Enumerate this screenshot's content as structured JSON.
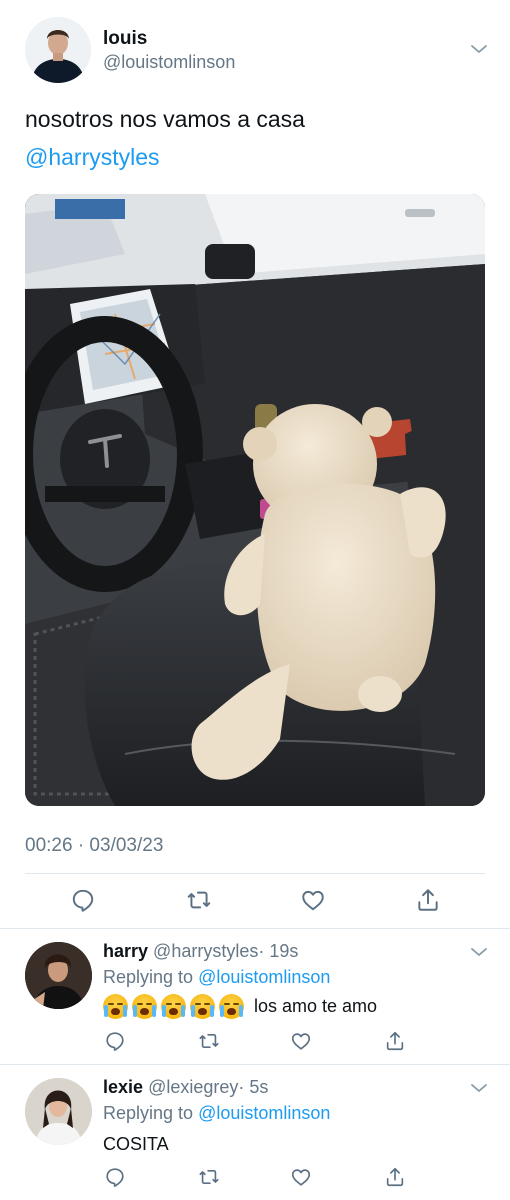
{
  "tweet": {
    "author_name": "louis",
    "author_handle": "@louistomlinson",
    "text": "nosotros nos vamos a casa",
    "mention": "@harrystyles",
    "timestamp": "00:26 · 03/03/23",
    "actions": [
      "reply-icon",
      "retweet-icon",
      "like-icon",
      "share-icon"
    ]
  },
  "replies": [
    {
      "name": "harry",
      "handle": "@harrystyles",
      "time": "· 19s",
      "replying_label": "Replying to",
      "replying_to": "@louistomlinson",
      "emoji": [
        "loudly-crying-face",
        "loudly-crying-face",
        "loudly-crying-face",
        "loudly-crying-face",
        "loudly-crying-face"
      ],
      "text": "los amo te amo"
    },
    {
      "name": "lexie",
      "handle": "@lexiegrey",
      "time": "· 5s",
      "replying_label": "Replying to",
      "replying_to": "@louistomlinson",
      "text": "COSITA"
    }
  ],
  "colors": {
    "link": "#1d9bf0",
    "secondary_text": "#657786",
    "divider": "#e1e8ed",
    "icon": "#5b7083"
  }
}
